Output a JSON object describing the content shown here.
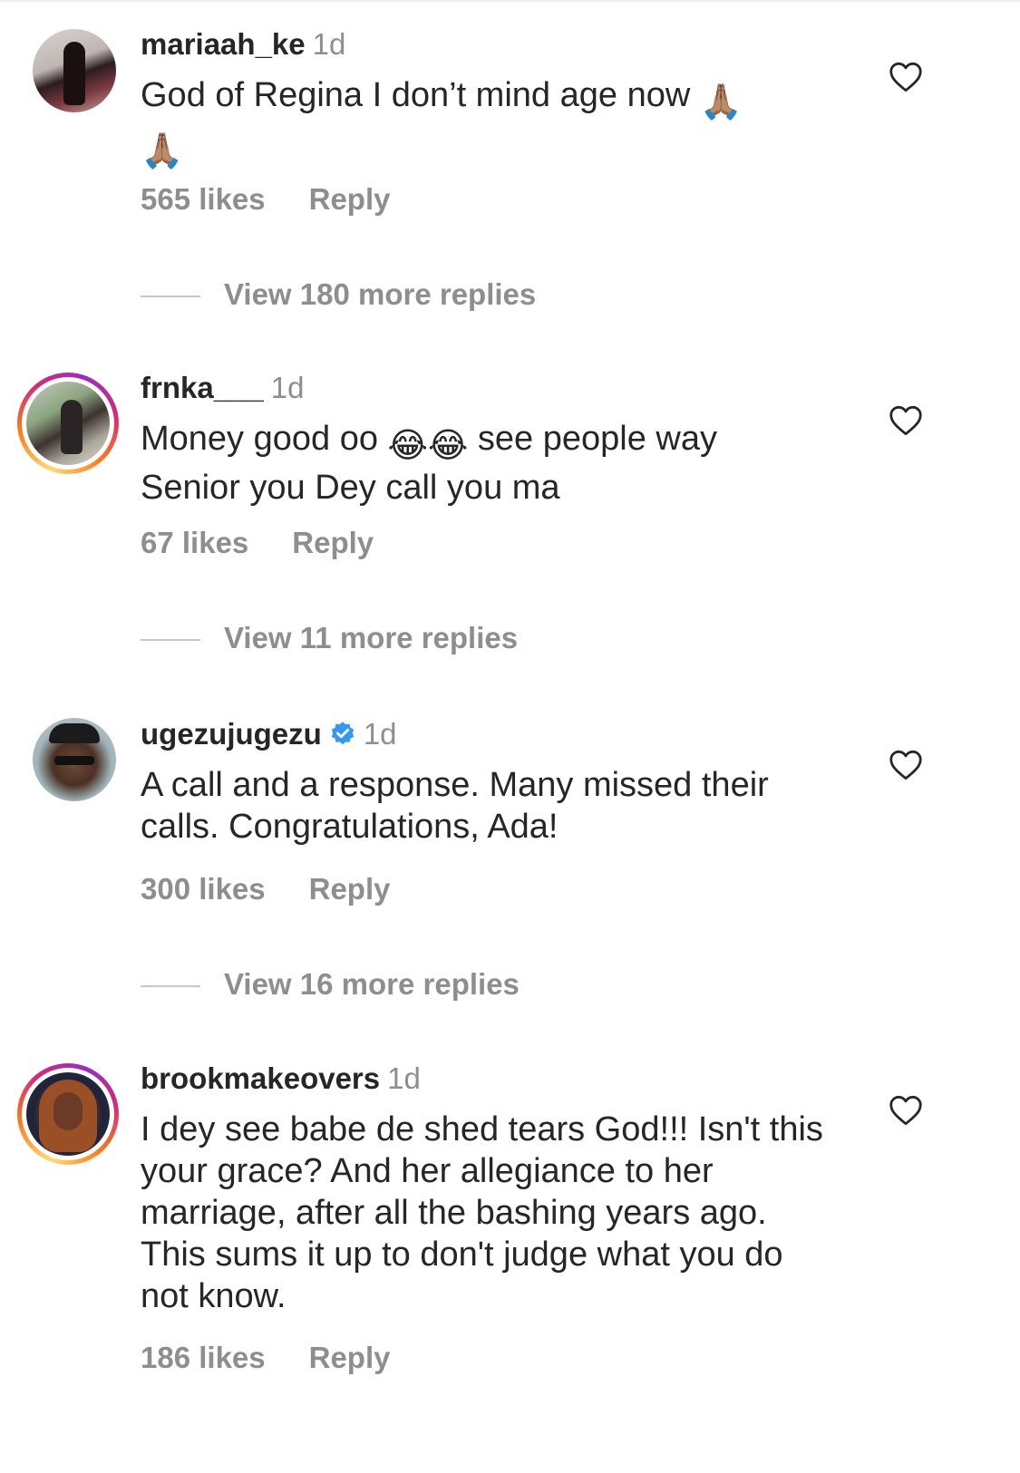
{
  "comments": [
    {
      "username": "mariaah_ke",
      "time": "1d",
      "verified": false,
      "text": "God of Regina I don’t mind age now ",
      "emoji_after": "🙏🏽",
      "emoji_line2": "🙏🏽",
      "likes": "565 likes",
      "reply": "Reply",
      "view_more": "View 180 more replies"
    },
    {
      "username": "frnka___",
      "time": "1d",
      "verified": false,
      "text_part1": "Money good oo ",
      "emoji_mid": "😂😂",
      "text_part2": " see people way",
      "text_line2": "Senior you Dey call you ma",
      "likes": "67 likes",
      "reply": "Reply",
      "view_more": "View 11 more replies"
    },
    {
      "username": "ugezujugezu",
      "time": "1d",
      "verified": true,
      "text": "A call and a response. Many missed their calls. Congratulations, Ada!",
      "likes": "300 likes",
      "reply": "Reply",
      "view_more": "View 16 more replies"
    },
    {
      "username": "brookmakeovers",
      "time": "1d",
      "verified": false,
      "text": "I dey see babe de shed tears God!!! Isn't this your grace? And her allegiance to her marriage, after all the bashing years ago. This sums it up to don't judge what you do not know.",
      "likes": "186 likes",
      "reply": "Reply"
    }
  ],
  "colors": {
    "primary_text": "#262626",
    "secondary_text": "#8e8e8e",
    "verified_blue": "#3897f0"
  },
  "icons": {
    "like": "heart-outline-icon",
    "verified": "verified-badge-icon"
  }
}
